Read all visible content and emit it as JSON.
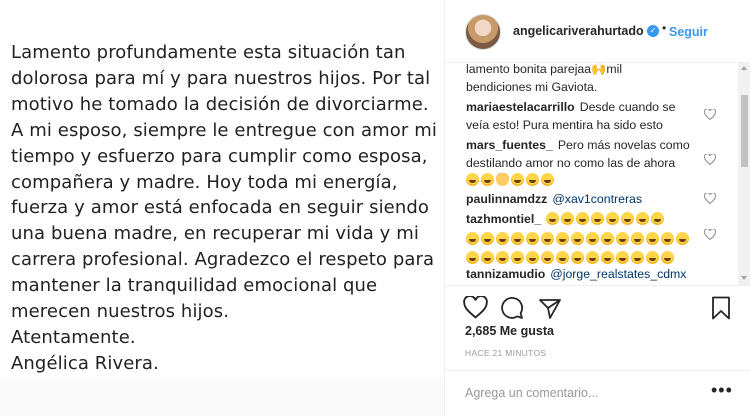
{
  "post_image": {
    "lines": [
      "Lamento profundamente esta situación tan",
      "dolorosa para mí y para nuestros hijos. Por tal",
      "motivo he tomado la decisión de divorciarme.",
      "A mi esposo, siempre le entregue con amor mi",
      "tiempo y esfuerzo para cumplir como esposa,",
      "compañera y madre. Hoy toda mi energía,",
      "fuerza y amor está enfocada en seguir siendo",
      "una buena madre, en recuperar mi vida y mi",
      "carrera profesional. Agradezco el respeto para",
      "mantener la tranquilidad emocional que",
      "merecen nuestros hijos.",
      "Atentamente.",
      "Angélica Rivera."
    ]
  },
  "header": {
    "username": "angelicariverahurtado",
    "verified_icon": "verified-badge-icon",
    "separator": "•",
    "follow_label": "Seguir"
  },
  "comments": [
    {
      "user": "",
      "text": "lamento bonita parejaa🙌mil",
      "line2": "bendiciones mi Gaviota."
    },
    {
      "user": "mariaestelacarrillo",
      "text": "Desde cuando se",
      "line2": "veía esto! Pura mentira ha sido esto"
    },
    {
      "user": "mars_fuentes_",
      "text": "Pero más novelas como",
      "line2": "destilando amor no como las de ahora"
    },
    {
      "user": "paulinnamdzz",
      "text": "@xav1contreras"
    },
    {
      "user": "tazhmontiel_",
      "text": ""
    },
    {
      "user": "tannizamudio",
      "text": "@jorge_realstates_cdmx"
    }
  ],
  "actions": {
    "like_icon": "heart-icon",
    "comment_icon": "comment-bubble-icon",
    "share_icon": "share-arrow-icon",
    "save_icon": "bookmark-icon"
  },
  "likes_text": "2,685 Me gusta",
  "time_ago": "HACE 21 MINUTOS",
  "comment_input": {
    "placeholder": "Agrega un comentario...",
    "more_label": "•••"
  }
}
